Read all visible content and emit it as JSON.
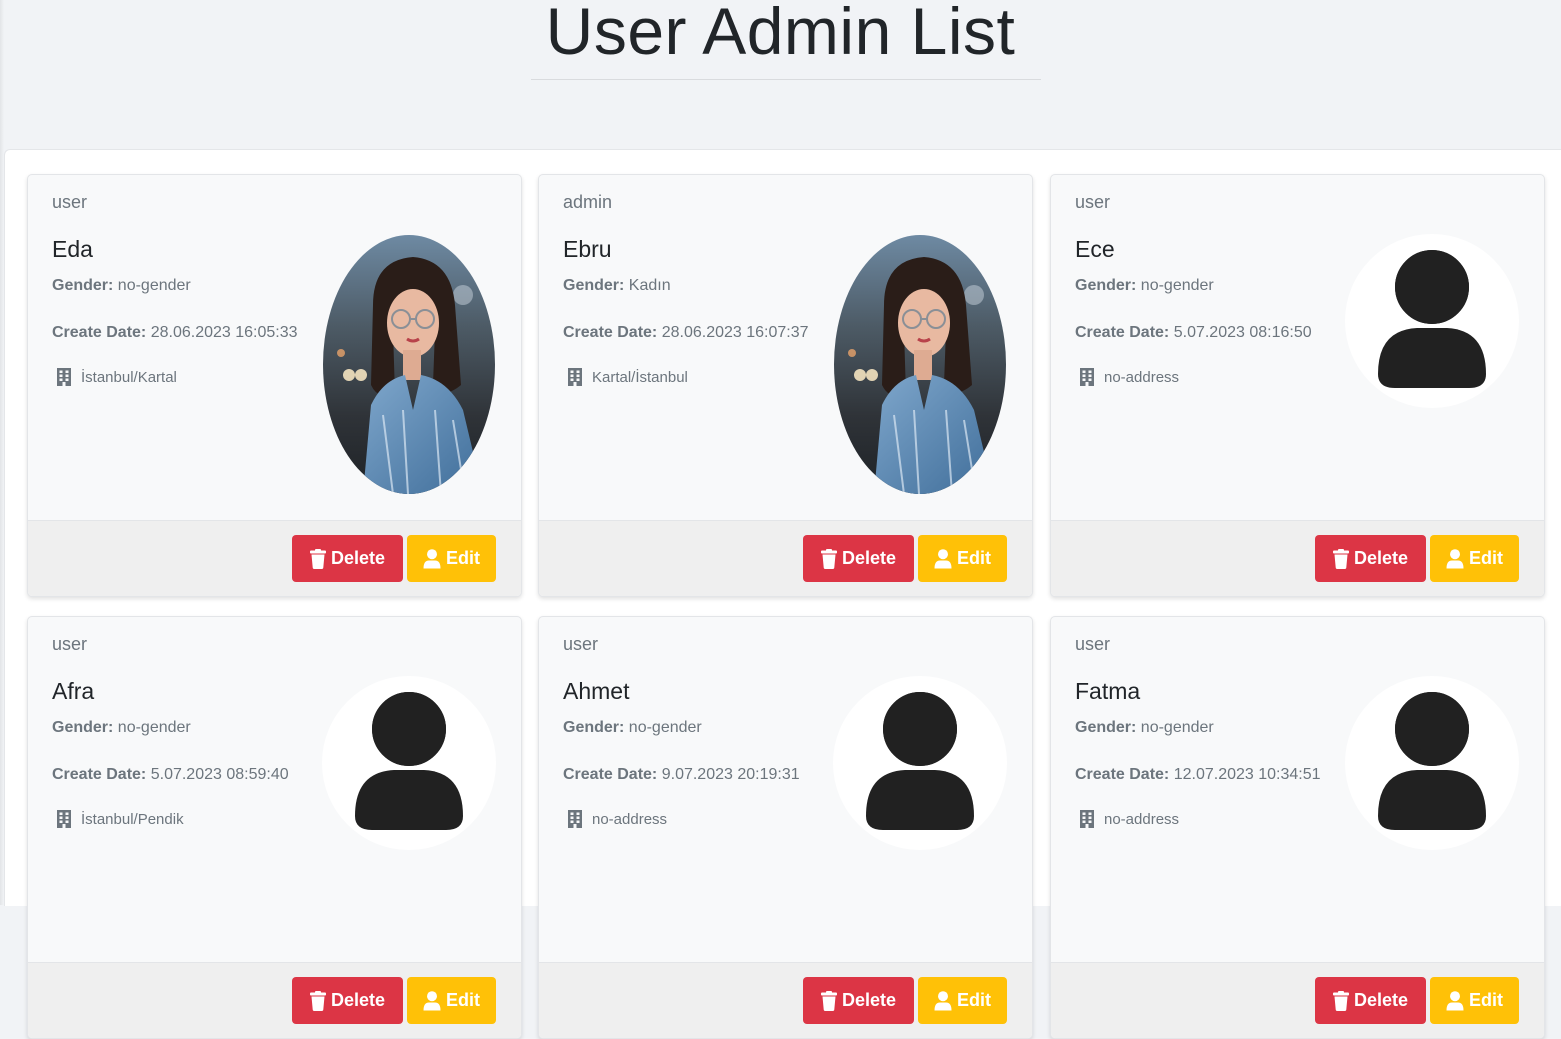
{
  "page": {
    "title": "User Admin List"
  },
  "labels": {
    "gender": "Gender:",
    "create_date": "Create Date:",
    "delete": "Delete",
    "edit": "Edit"
  },
  "colors": {
    "delete_button": "#dc3545",
    "edit_button": "#ffc107",
    "page_background": "#f1f3f6",
    "card_background": "#f8f9fa"
  },
  "users": [
    {
      "role": "user",
      "name": "Eda",
      "gender": "no-gender",
      "create_date": "28.06.2023 16:05:33",
      "address": "İstanbul/Kartal",
      "avatar": "photo"
    },
    {
      "role": "admin",
      "name": "Ebru",
      "gender": "Kadın",
      "create_date": "28.06.2023 16:07:37",
      "address": "Kartal/İstanbul",
      "avatar": "photo"
    },
    {
      "role": "user",
      "name": "Ece",
      "gender": "no-gender",
      "create_date": "5.07.2023 08:16:50",
      "address": "no-address",
      "avatar": "default"
    },
    {
      "role": "user",
      "name": "Afra",
      "gender": "no-gender",
      "create_date": "5.07.2023 08:59:40",
      "address": "İstanbul/Pendik",
      "avatar": "default"
    },
    {
      "role": "user",
      "name": "Ahmet",
      "gender": "no-gender",
      "create_date": "9.07.2023 20:19:31",
      "address": "no-address",
      "avatar": "default"
    },
    {
      "role": "user",
      "name": "Fatma",
      "gender": "no-gender",
      "create_date": "12.07.2023 10:34:51",
      "address": "no-address",
      "avatar": "default"
    }
  ]
}
